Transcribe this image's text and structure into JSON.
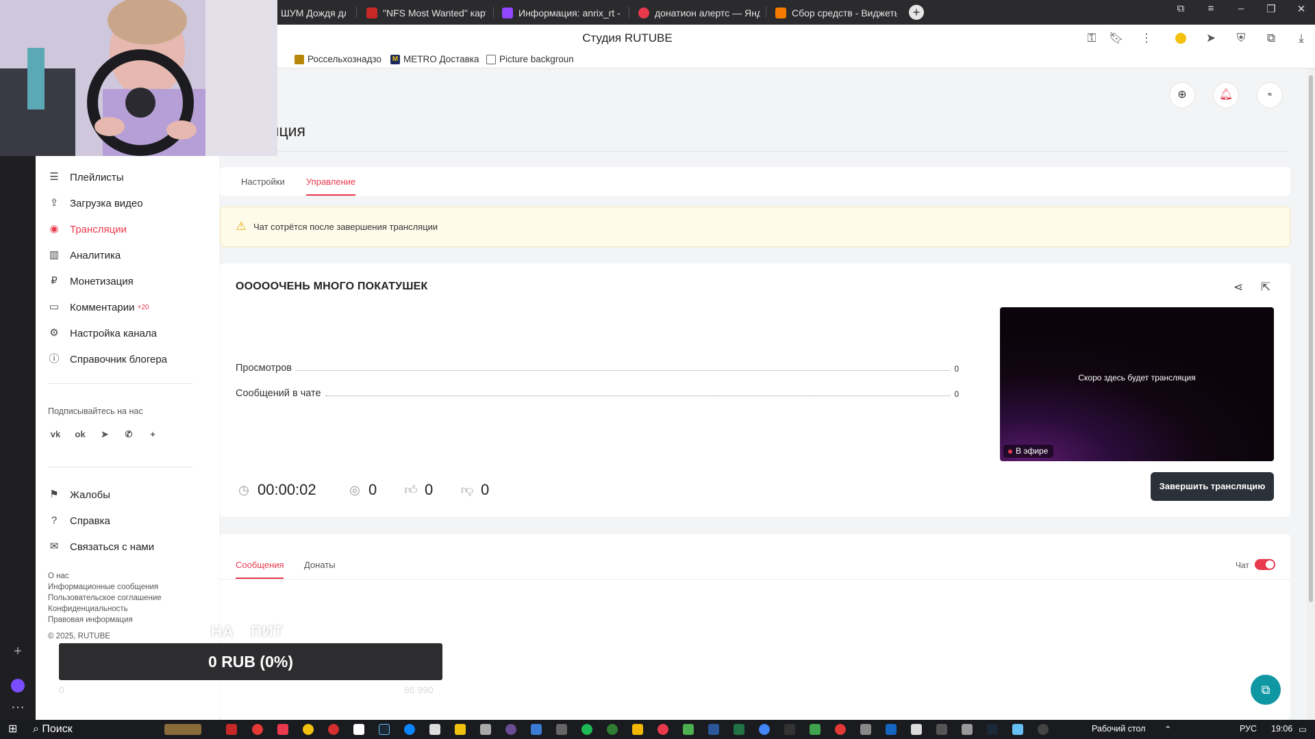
{
  "browser": {
    "tabs": [
      {
        "label": "ШУМ Дождя для с",
        "color": "#e8394d"
      },
      {
        "label": "\"NFS Most Wanted\" карта",
        "color": "#e8394d"
      },
      {
        "label": "Информация: anrix_rt - Tw",
        "color": "#9146ff"
      },
      {
        "label": "донатион алертс — Янде",
        "color": "#e8394d"
      },
      {
        "label": "Сбор средств - Виджеты",
        "color": "#f57c00"
      }
    ],
    "page_title": "Студия RUTUBE",
    "bookmarks": [
      {
        "label": "Россельхознадзо",
        "icon": "eagle-icon"
      },
      {
        "label": "METRO Доставка",
        "icon": "metro-icon"
      },
      {
        "label": "Picture backgroun",
        "icon": "page-icon"
      }
    ]
  },
  "sidebar": {
    "items": [
      {
        "label": "Плейлисты",
        "icon": "list-icon"
      },
      {
        "label": "Загрузка видео",
        "icon": "upload-icon"
      },
      {
        "label": "Трансляции",
        "icon": "broadcast-icon",
        "active": true
      },
      {
        "label": "Аналитика",
        "icon": "chart-icon"
      },
      {
        "label": "Монетизация",
        "icon": "ruble-icon"
      },
      {
        "label": "Комментарии",
        "icon": "comment-icon",
        "badge": "+20"
      },
      {
        "label": "Настройка канала",
        "icon": "gear-icon"
      },
      {
        "label": "Справочник блогера",
        "icon": "info-icon"
      }
    ],
    "follow_label": "Подписывайтесь на нас",
    "bottom_items": [
      {
        "label": "Жалобы",
        "icon": "flag-icon"
      },
      {
        "label": "Справка",
        "icon": "help-icon"
      },
      {
        "label": "Связаться с нами",
        "icon": "mail-icon"
      }
    ],
    "footer_links": [
      "О нас",
      "Информационные сообщения",
      "Пользовательское соглашение",
      "Конфиденциальность",
      "Правовая информация"
    ],
    "copyright": "© 2025, RUTUBE"
  },
  "main": {
    "page_title": "яция",
    "tabs": [
      "Настройки",
      "Управление"
    ],
    "alert": "Чат сотрётся после завершения трансляции",
    "stream_title": "ОООООЧЕНЬ МНОГО ПОКАТУШЕК",
    "stats": [
      {
        "label": "Просмотров",
        "value": "0"
      },
      {
        "label": "Сообщений в чате",
        "value": "0"
      }
    ],
    "preview_text": "Скоро здесь будет трансляция",
    "live_label": "В эфире",
    "metrics": {
      "duration": "00:00:02",
      "viewers": "0",
      "likes": "0",
      "dislikes": "0"
    },
    "end_button": "Завершить трансляцию",
    "chat_tabs": [
      "Сообщения",
      "Донаты"
    ],
    "chat_toggle_label": "Чат"
  },
  "overlay": {
    "donation_labels": [
      "НА",
      "ПИТ"
    ],
    "donation_amount": "0 RUB (0%)",
    "donation_min": "0",
    "donation_max": "86 990"
  },
  "taskbar": {
    "search": "Поиск",
    "desktop_label": "Рабочий стол",
    "lang": "РУС",
    "time": "19:06"
  },
  "colors": {
    "accent": "#e8394d",
    "button_dark": "#2b3138"
  }
}
